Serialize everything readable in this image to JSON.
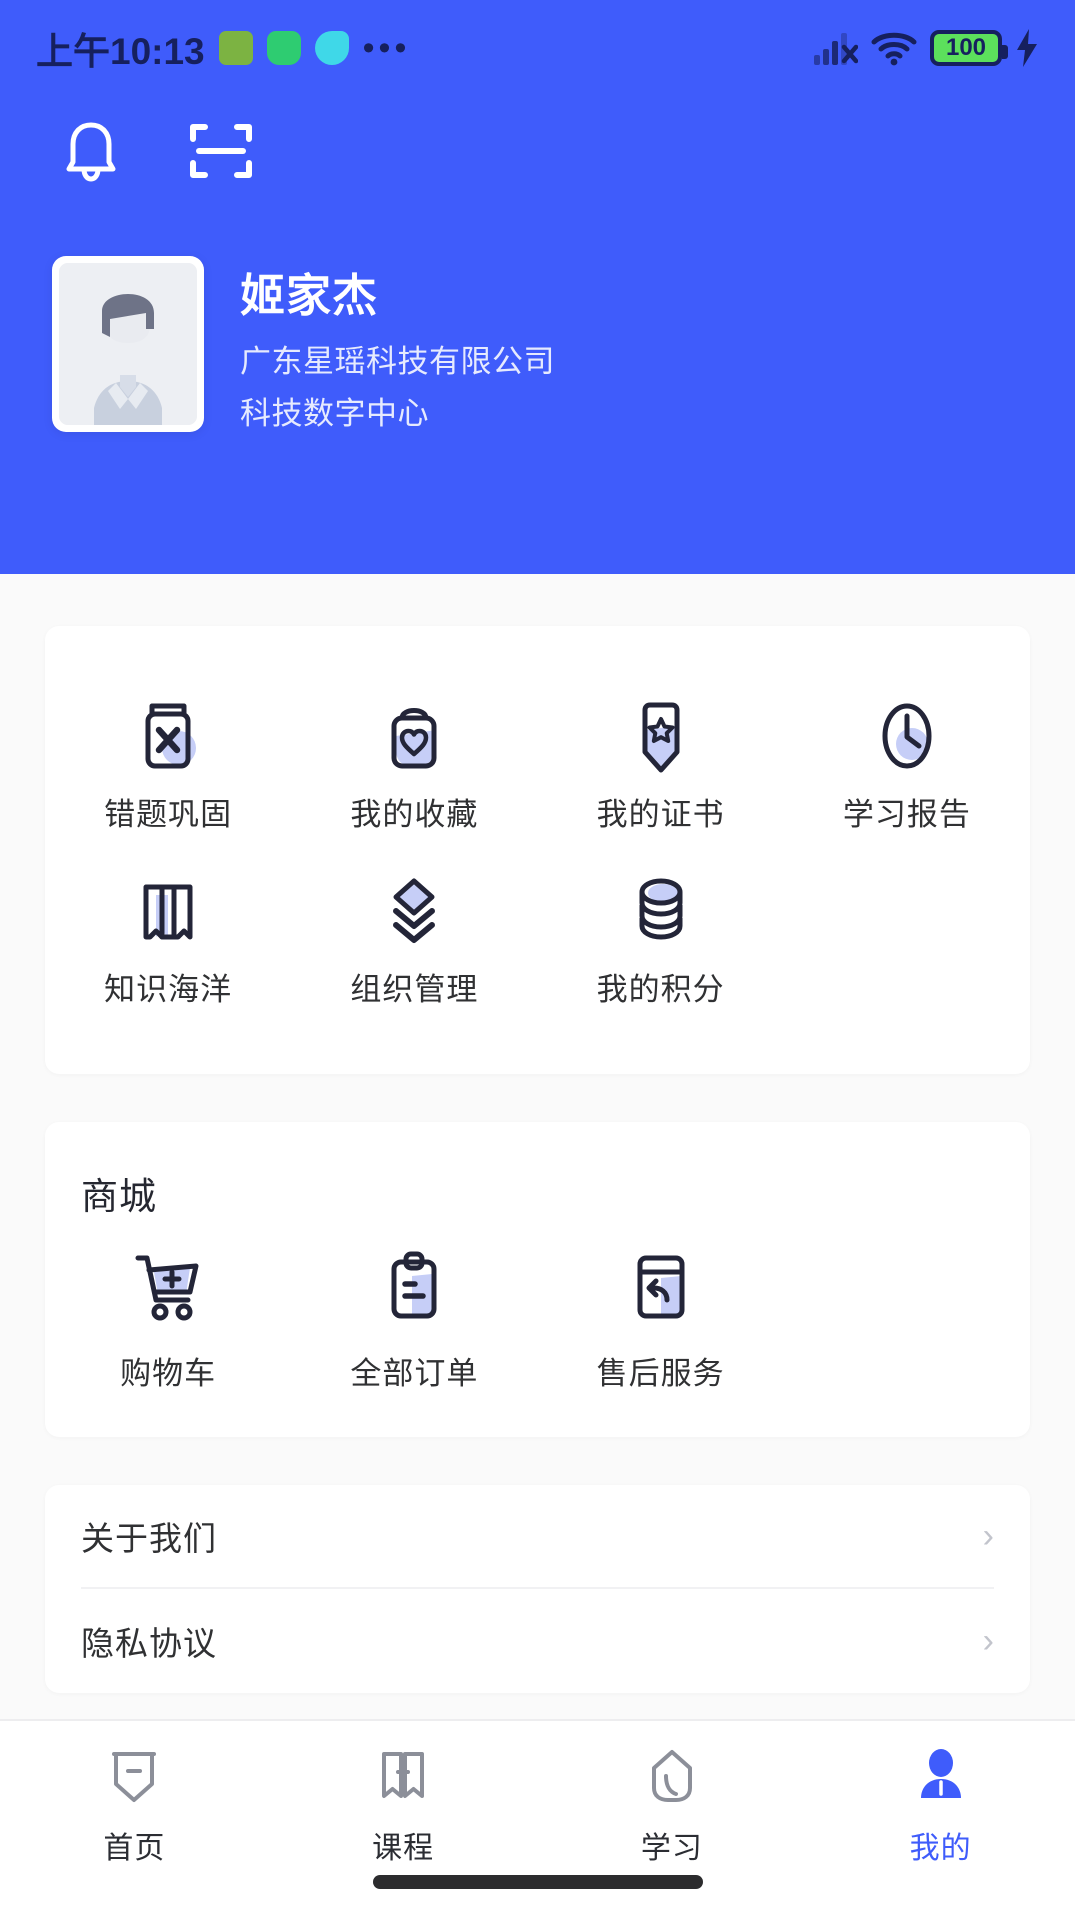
{
  "statusbar": {
    "time": "上午10:13",
    "overflow_dots": "•••",
    "battery_level": "100",
    "icons": [
      "android-badge-icon",
      "shield-bolt-icon",
      "leaf-icon",
      "more-dots-icon",
      "cellular-signal-off-icon",
      "wifi-icon",
      "battery-icon",
      "charging-bolt-icon"
    ]
  },
  "header": {
    "notification_icon": "bell-icon",
    "scan_icon": "scan-qr-icon",
    "avatar_alt": "default-user-avatar",
    "accent_color": "#3F5CFB",
    "profile": {
      "name": "姬家杰",
      "company": "广东星瑶科技有限公司",
      "department": "科技数字中心"
    }
  },
  "quick_grid": {
    "items": [
      {
        "label": "错题巩固",
        "icon": "wrong-question-icon"
      },
      {
        "label": "我的收藏",
        "icon": "favorite-heart-icon"
      },
      {
        "label": "我的证书",
        "icon": "certificate-badge-icon"
      },
      {
        "label": "学习报告",
        "icon": "clock-report-icon"
      },
      {
        "label": "知识海洋",
        "icon": "open-book-icon"
      },
      {
        "label": "组织管理",
        "icon": "layers-org-icon"
      },
      {
        "label": "我的积分",
        "icon": "coins-stack-icon"
      }
    ]
  },
  "shop": {
    "title": "商城",
    "items": [
      {
        "label": "购物车",
        "icon": "shopping-cart-icon"
      },
      {
        "label": "全部订单",
        "icon": "clipboard-order-icon"
      },
      {
        "label": "售后服务",
        "icon": "return-box-icon"
      }
    ]
  },
  "about_list": {
    "items": [
      {
        "label": "关于我们",
        "chevron": "›"
      },
      {
        "label": "隐私协议",
        "chevron": "›"
      }
    ]
  },
  "tabbar": {
    "active_color": "#3F5CFB",
    "items": [
      {
        "label": "首页",
        "icon": "home-tab-icon",
        "active": false
      },
      {
        "label": "课程",
        "icon": "course-book-tab-icon",
        "active": false
      },
      {
        "label": "学习",
        "icon": "study-tab-icon",
        "active": false
      },
      {
        "label": "我的",
        "icon": "profile-person-tab-icon",
        "active": true
      }
    ]
  }
}
